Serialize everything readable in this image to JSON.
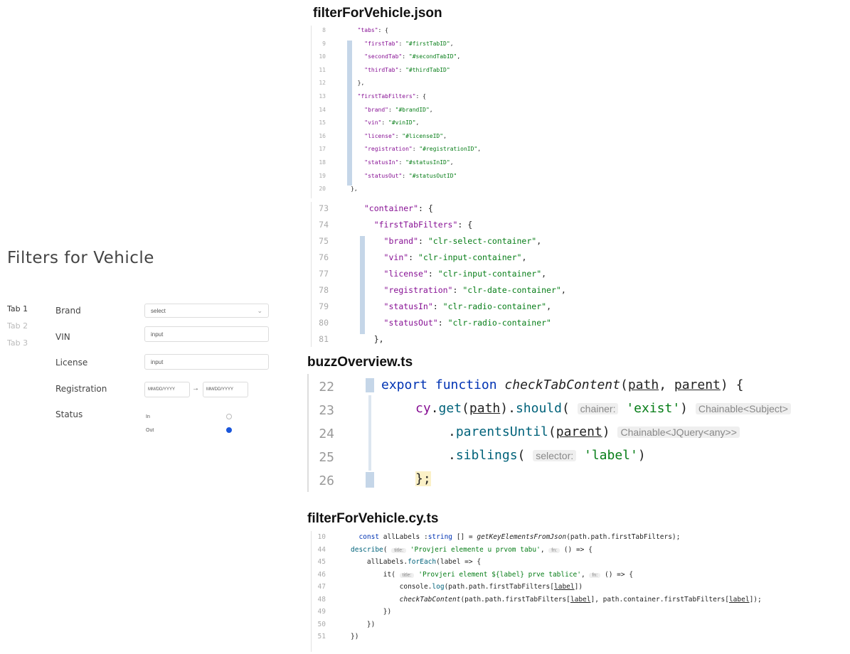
{
  "form": {
    "title": "Filters for Vehicle",
    "tabs": [
      "Tab 1",
      "Tab 2",
      "Tab 3"
    ],
    "fields": {
      "brand": {
        "label": "Brand",
        "value": "select"
      },
      "vin": {
        "label": "VIN",
        "value": "input"
      },
      "license": {
        "label": "License",
        "value": "input"
      },
      "registration": {
        "label": "Registration",
        "from": "MM/DD/YYYY",
        "to": "MM/DD/YYYY",
        "arrow": "→"
      },
      "status": {
        "label": "Status",
        "options": [
          "In",
          "Out"
        ],
        "selected": "Out"
      }
    }
  },
  "json1": {
    "title": "filterForVehicle.json",
    "lines": [
      {
        "n": "8",
        "t": "  \"tabs\": {"
      },
      {
        "n": "9",
        "t": "    \"firstTab\": \"#firstTabID\","
      },
      {
        "n": "10",
        "t": "    \"secondTab\": \"#secondTabID\","
      },
      {
        "n": "11",
        "t": "    \"thirdTab\": \"#thirdTabID\""
      },
      {
        "n": "12",
        "t": "  },"
      },
      {
        "n": "13",
        "t": "  \"firstTabFilters\": {"
      },
      {
        "n": "14",
        "t": "    \"brand\": \"#brandID\","
      },
      {
        "n": "15",
        "t": "    \"vin\": \"#vinID\","
      },
      {
        "n": "16",
        "t": "    \"license\": \"#licenseID\","
      },
      {
        "n": "17",
        "t": "    \"registration\": \"#registrationID\","
      },
      {
        "n": "18",
        "t": "    \"statusIn\": \"#statusInID\","
      },
      {
        "n": "19",
        "t": "    \"statusOut\": \"#statusOutID\""
      },
      {
        "n": "20",
        "t": "},"
      }
    ]
  },
  "json2": {
    "lines": [
      {
        "n": "73",
        "t": "  \"container\": {"
      },
      {
        "n": "74",
        "t": "    \"firstTabFilters\": {"
      },
      {
        "n": "75",
        "t": "      \"brand\": \"clr-select-container\","
      },
      {
        "n": "76",
        "t": "      \"vin\": \"clr-input-container\","
      },
      {
        "n": "77",
        "t": "      \"license\": \"clr-input-container\","
      },
      {
        "n": "78",
        "t": "      \"registration\": \"clr-date-container\","
      },
      {
        "n": "79",
        "t": "      \"statusIn\": \"clr-radio-container\","
      },
      {
        "n": "80",
        "t": "      \"statusOut\": \"clr-radio-container\""
      },
      {
        "n": "81",
        "t": "    },"
      }
    ]
  },
  "ts": {
    "title": "buzzOverview.ts",
    "line_numbers": [
      "22",
      "23",
      "24",
      "25",
      "26"
    ],
    "export": "export",
    "function": "function",
    "fn_name": "checkTabContent",
    "param_path": "path",
    "param_parent": "parent",
    "cy": "cy",
    "get": "get",
    "should": "should",
    "chainer_hint": "chainer:",
    "exist": "'exist'",
    "type_hint1": "Chainable<Subject>",
    "parents_until": "parentsUntil",
    "type_hint2": "Chainable<JQuery<any>>",
    "siblings": "siblings",
    "selector_hint": "selector:",
    "label_str": "'label'",
    "close": "};"
  },
  "cy": {
    "title": "filterForVehicle.cy.ts",
    "lines": [
      {
        "n": "10",
        "t": "  const allLabels :string [] = getKeyElementsFromJson(path.path.firstTabFilters);"
      },
      {
        "n": "44",
        "t": "describe( title: 'Provjeri elemente u prvom tabu', fn: () => {"
      },
      {
        "n": "45",
        "t": "    allLabels.forEach(label => {"
      },
      {
        "n": "46",
        "t": "        it( title: 'Provjeri element ${label} prve tablice', fn: () => {"
      },
      {
        "n": "47",
        "t": "            console.log(path.path.firstTabFilters[label])"
      },
      {
        "n": "48",
        "t": "            checkTabContent(path.path.firstTabFilters[label], path.container.firstTabFilters[label]);"
      },
      {
        "n": "49",
        "t": "        })"
      },
      {
        "n": "50",
        "t": "    })"
      },
      {
        "n": "51",
        "t": "})"
      }
    ]
  }
}
